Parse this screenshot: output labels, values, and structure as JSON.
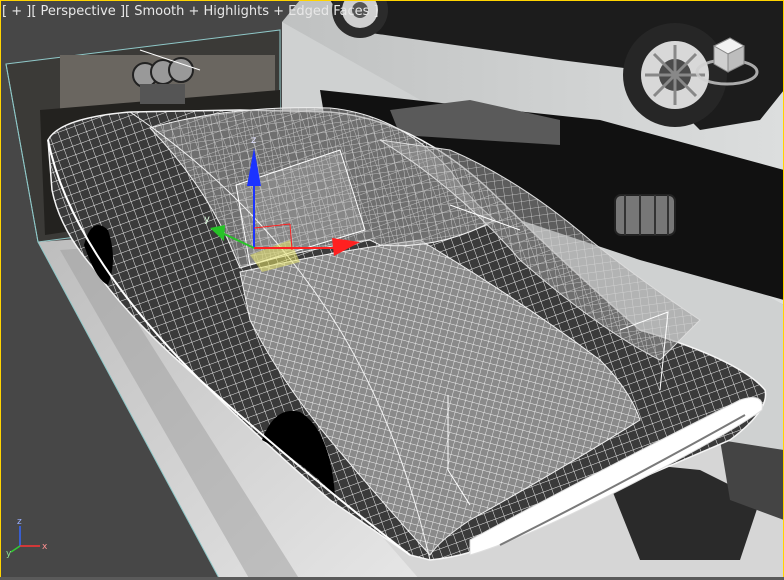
{
  "viewport": {
    "label_menu": "[ + ]",
    "label_view": "[ Perspective ]",
    "label_shading": "[ Smooth + Highlights + Edged Faces ]",
    "active_border_color": "#ffd400"
  },
  "viewcube": {
    "icon": "viewcube-icon"
  },
  "axis_tripod": {
    "x": "x",
    "y": "y",
    "z": "z"
  },
  "transform_gizmo": {
    "icon": "move-gizmo-icon"
  }
}
